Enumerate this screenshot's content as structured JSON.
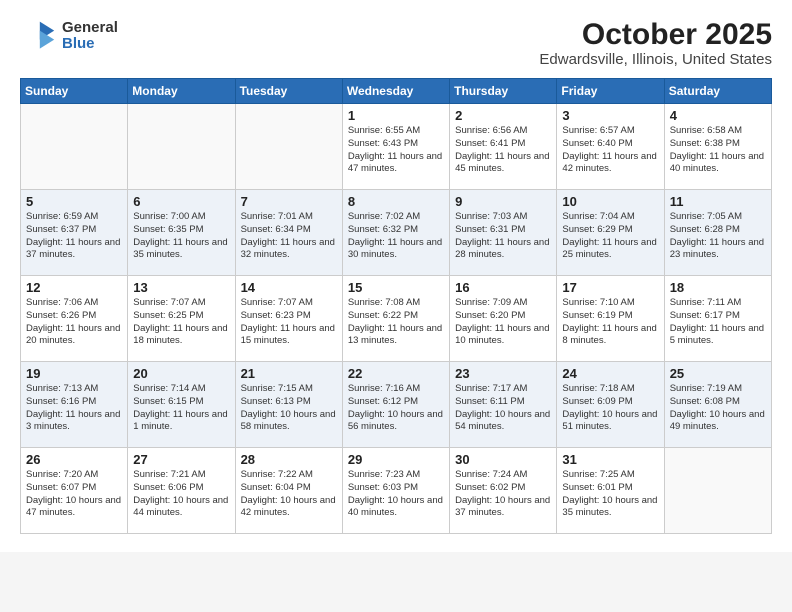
{
  "header": {
    "logo_line1": "General",
    "logo_line2": "Blue",
    "title": "October 2025",
    "subtitle": "Edwardsville, Illinois, United States"
  },
  "weekdays": [
    "Sunday",
    "Monday",
    "Tuesday",
    "Wednesday",
    "Thursday",
    "Friday",
    "Saturday"
  ],
  "weeks": [
    [
      {
        "day": "",
        "sunrise": "",
        "sunset": "",
        "daylight": ""
      },
      {
        "day": "",
        "sunrise": "",
        "sunset": "",
        "daylight": ""
      },
      {
        "day": "",
        "sunrise": "",
        "sunset": "",
        "daylight": ""
      },
      {
        "day": "1",
        "sunrise": "Sunrise: 6:55 AM",
        "sunset": "Sunset: 6:43 PM",
        "daylight": "Daylight: 11 hours and 47 minutes."
      },
      {
        "day": "2",
        "sunrise": "Sunrise: 6:56 AM",
        "sunset": "Sunset: 6:41 PM",
        "daylight": "Daylight: 11 hours and 45 minutes."
      },
      {
        "day": "3",
        "sunrise": "Sunrise: 6:57 AM",
        "sunset": "Sunset: 6:40 PM",
        "daylight": "Daylight: 11 hours and 42 minutes."
      },
      {
        "day": "4",
        "sunrise": "Sunrise: 6:58 AM",
        "sunset": "Sunset: 6:38 PM",
        "daylight": "Daylight: 11 hours and 40 minutes."
      }
    ],
    [
      {
        "day": "5",
        "sunrise": "Sunrise: 6:59 AM",
        "sunset": "Sunset: 6:37 PM",
        "daylight": "Daylight: 11 hours and 37 minutes."
      },
      {
        "day": "6",
        "sunrise": "Sunrise: 7:00 AM",
        "sunset": "Sunset: 6:35 PM",
        "daylight": "Daylight: 11 hours and 35 minutes."
      },
      {
        "day": "7",
        "sunrise": "Sunrise: 7:01 AM",
        "sunset": "Sunset: 6:34 PM",
        "daylight": "Daylight: 11 hours and 32 minutes."
      },
      {
        "day": "8",
        "sunrise": "Sunrise: 7:02 AM",
        "sunset": "Sunset: 6:32 PM",
        "daylight": "Daylight: 11 hours and 30 minutes."
      },
      {
        "day": "9",
        "sunrise": "Sunrise: 7:03 AM",
        "sunset": "Sunset: 6:31 PM",
        "daylight": "Daylight: 11 hours and 28 minutes."
      },
      {
        "day": "10",
        "sunrise": "Sunrise: 7:04 AM",
        "sunset": "Sunset: 6:29 PM",
        "daylight": "Daylight: 11 hours and 25 minutes."
      },
      {
        "day": "11",
        "sunrise": "Sunrise: 7:05 AM",
        "sunset": "Sunset: 6:28 PM",
        "daylight": "Daylight: 11 hours and 23 minutes."
      }
    ],
    [
      {
        "day": "12",
        "sunrise": "Sunrise: 7:06 AM",
        "sunset": "Sunset: 6:26 PM",
        "daylight": "Daylight: 11 hours and 20 minutes."
      },
      {
        "day": "13",
        "sunrise": "Sunrise: 7:07 AM",
        "sunset": "Sunset: 6:25 PM",
        "daylight": "Daylight: 11 hours and 18 minutes."
      },
      {
        "day": "14",
        "sunrise": "Sunrise: 7:07 AM",
        "sunset": "Sunset: 6:23 PM",
        "daylight": "Daylight: 11 hours and 15 minutes."
      },
      {
        "day": "15",
        "sunrise": "Sunrise: 7:08 AM",
        "sunset": "Sunset: 6:22 PM",
        "daylight": "Daylight: 11 hours and 13 minutes."
      },
      {
        "day": "16",
        "sunrise": "Sunrise: 7:09 AM",
        "sunset": "Sunset: 6:20 PM",
        "daylight": "Daylight: 11 hours and 10 minutes."
      },
      {
        "day": "17",
        "sunrise": "Sunrise: 7:10 AM",
        "sunset": "Sunset: 6:19 PM",
        "daylight": "Daylight: 11 hours and 8 minutes."
      },
      {
        "day": "18",
        "sunrise": "Sunrise: 7:11 AM",
        "sunset": "Sunset: 6:17 PM",
        "daylight": "Daylight: 11 hours and 5 minutes."
      }
    ],
    [
      {
        "day": "19",
        "sunrise": "Sunrise: 7:13 AM",
        "sunset": "Sunset: 6:16 PM",
        "daylight": "Daylight: 11 hours and 3 minutes."
      },
      {
        "day": "20",
        "sunrise": "Sunrise: 7:14 AM",
        "sunset": "Sunset: 6:15 PM",
        "daylight": "Daylight: 11 hours and 1 minute."
      },
      {
        "day": "21",
        "sunrise": "Sunrise: 7:15 AM",
        "sunset": "Sunset: 6:13 PM",
        "daylight": "Daylight: 10 hours and 58 minutes."
      },
      {
        "day": "22",
        "sunrise": "Sunrise: 7:16 AM",
        "sunset": "Sunset: 6:12 PM",
        "daylight": "Daylight: 10 hours and 56 minutes."
      },
      {
        "day": "23",
        "sunrise": "Sunrise: 7:17 AM",
        "sunset": "Sunset: 6:11 PM",
        "daylight": "Daylight: 10 hours and 54 minutes."
      },
      {
        "day": "24",
        "sunrise": "Sunrise: 7:18 AM",
        "sunset": "Sunset: 6:09 PM",
        "daylight": "Daylight: 10 hours and 51 minutes."
      },
      {
        "day": "25",
        "sunrise": "Sunrise: 7:19 AM",
        "sunset": "Sunset: 6:08 PM",
        "daylight": "Daylight: 10 hours and 49 minutes."
      }
    ],
    [
      {
        "day": "26",
        "sunrise": "Sunrise: 7:20 AM",
        "sunset": "Sunset: 6:07 PM",
        "daylight": "Daylight: 10 hours and 47 minutes."
      },
      {
        "day": "27",
        "sunrise": "Sunrise: 7:21 AM",
        "sunset": "Sunset: 6:06 PM",
        "daylight": "Daylight: 10 hours and 44 minutes."
      },
      {
        "day": "28",
        "sunrise": "Sunrise: 7:22 AM",
        "sunset": "Sunset: 6:04 PM",
        "daylight": "Daylight: 10 hours and 42 minutes."
      },
      {
        "day": "29",
        "sunrise": "Sunrise: 7:23 AM",
        "sunset": "Sunset: 6:03 PM",
        "daylight": "Daylight: 10 hours and 40 minutes."
      },
      {
        "day": "30",
        "sunrise": "Sunrise: 7:24 AM",
        "sunset": "Sunset: 6:02 PM",
        "daylight": "Daylight: 10 hours and 37 minutes."
      },
      {
        "day": "31",
        "sunrise": "Sunrise: 7:25 AM",
        "sunset": "Sunset: 6:01 PM",
        "daylight": "Daylight: 10 hours and 35 minutes."
      },
      {
        "day": "",
        "sunrise": "",
        "sunset": "",
        "daylight": ""
      }
    ]
  ]
}
